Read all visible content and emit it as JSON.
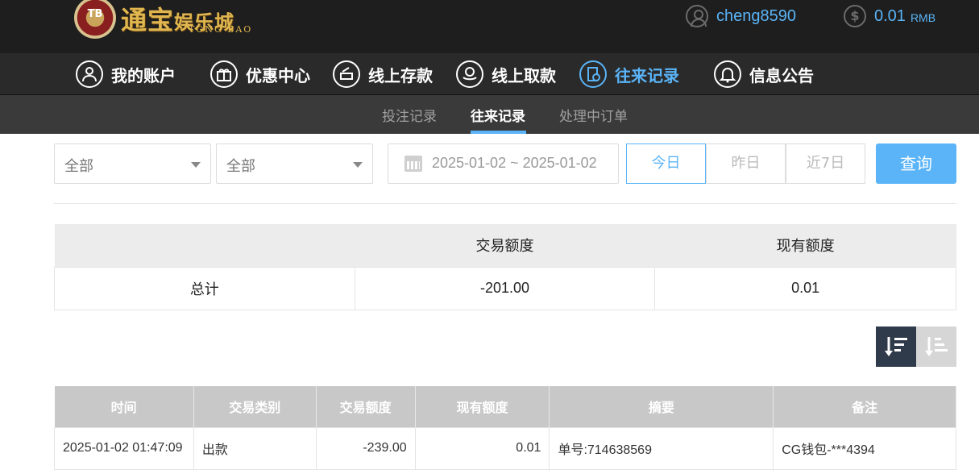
{
  "header": {
    "logo": {
      "chip_text": "TB",
      "title_main": "通宝",
      "title_small": "娱乐城",
      "subtitle": "TONG BAO"
    },
    "username": "cheng8590",
    "balance": "0.01",
    "currency": "RMB",
    "icons": {
      "user": "user-icon",
      "balance": "dollar-icon"
    }
  },
  "mainnav": {
    "items": [
      {
        "label": "我的账户",
        "icon": "user-icon"
      },
      {
        "label": "优惠中心",
        "icon": "gift-icon"
      },
      {
        "label": "线上存款",
        "icon": "deposit-icon"
      },
      {
        "label": "线上取款",
        "icon": "withdraw-icon"
      },
      {
        "label": "往来记录",
        "icon": "records-icon",
        "active": true
      },
      {
        "label": "信息公告",
        "icon": "bell-icon"
      }
    ]
  },
  "subnav": {
    "items": [
      {
        "label": "投注记录"
      },
      {
        "label": "往来记录",
        "active": true
      },
      {
        "label": "处理中订单"
      }
    ]
  },
  "filters": {
    "select1": "全部",
    "select2": "全部",
    "date_range": "2025-01-02 ~ 2025-01-02",
    "quick": [
      "今日",
      "昨日",
      "近7日"
    ],
    "quick_active": "今日",
    "query_label": "查询"
  },
  "summary": {
    "headers": [
      "",
      "交易额度",
      "现有额度"
    ],
    "row_label": "总计",
    "amount": "-201.00",
    "balance": "0.01"
  },
  "sort": {
    "desc_icon": "sort-desc-icon",
    "asc_icon": "sort-asc-icon"
  },
  "details": {
    "headers": [
      "时间",
      "交易类别",
      "交易额度",
      "现有额度",
      "摘要",
      "备注"
    ],
    "rows": [
      [
        "2025-01-02 01:47:09",
        "出款",
        "-239.00",
        "0.01",
        "单号:714638569",
        "CG钱包-***4394"
      ]
    ]
  },
  "colors": {
    "accent": "#5ab4f7",
    "topbar": "#1e1e1e",
    "nav": "#2a2a2a",
    "subnav": "#3a3a3a"
  }
}
